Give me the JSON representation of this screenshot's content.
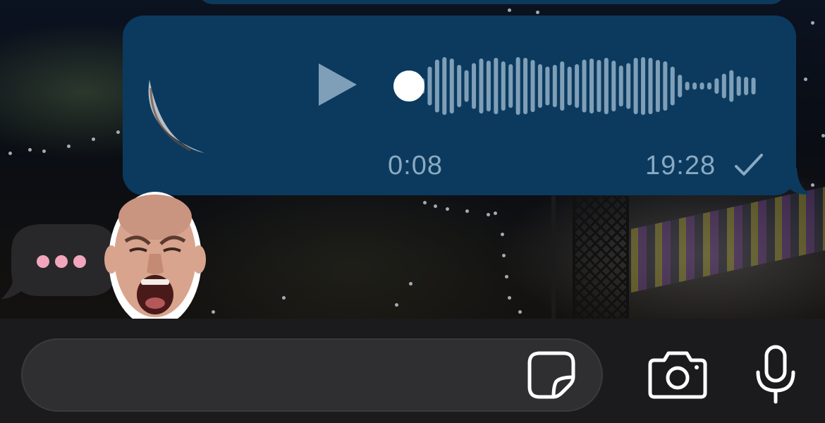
{
  "chat": {
    "voice_message": {
      "duration": "0:08",
      "time": "19:28",
      "status": "read",
      "play_icon": "play-icon",
      "check_icon": "checkmark-icon",
      "waveform_bars": [
        0.22,
        0.55,
        0.75,
        0.82,
        0.78,
        0.6,
        0.45,
        0.65,
        0.78,
        0.72,
        0.8,
        0.7,
        0.62,
        0.82,
        0.8,
        0.74,
        0.62,
        0.55,
        0.6,
        0.7,
        0.55,
        0.62,
        0.75,
        0.78,
        0.74,
        0.8,
        0.72,
        0.58,
        0.65,
        0.8,
        0.82,
        0.8,
        0.74,
        0.7,
        0.55,
        0.32,
        0.12,
        0.1,
        0.1,
        0.1,
        0.22,
        0.35,
        0.45,
        0.28,
        0.26,
        0.24
      ]
    },
    "typing_indicator": {
      "icon": "ellipsis-icon"
    },
    "sticker": {
      "name": "screaming-man-sticker"
    }
  },
  "composer": {
    "placeholder": "",
    "sticker_icon": "sticker-icon",
    "camera_icon": "camera-icon",
    "mic_icon": "microphone-icon"
  },
  "colors": {
    "bubble": "#0b3a5e",
    "meta_text": "#8aa9c2",
    "waveform": "#7f9fb8",
    "typing_dot": "#f2a6bd",
    "input_bg": "#2f2f31"
  }
}
